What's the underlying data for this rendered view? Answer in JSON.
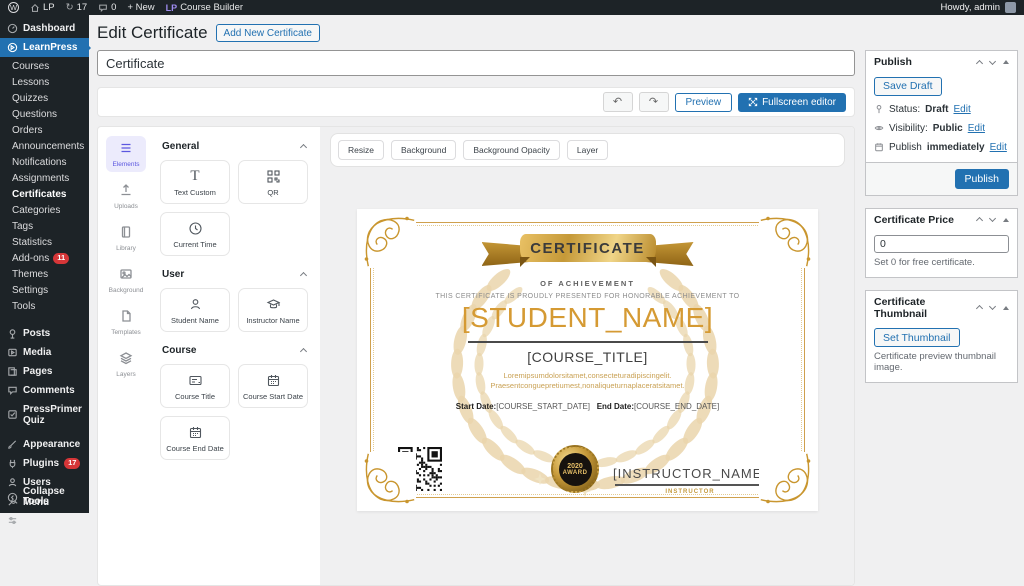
{
  "admin_bar": {
    "wp": "W",
    "site": "LP",
    "updates": "17",
    "comments": "0",
    "new_label": "+ New",
    "builder_logo": "LP",
    "builder": "Course Builder",
    "update_glyph": "↻",
    "howdy": "Howdy, admin"
  },
  "sidebar": {
    "dashboard": "Dashboard",
    "learnpress": "LearnPress",
    "lp_submenu": [
      "Courses",
      "Lessons",
      "Quizzes",
      "Questions",
      "Orders",
      "Announcements",
      "Notifications",
      "Assignments",
      "Certificates",
      "Categories",
      "Tags",
      "Statistics",
      "Add-ons",
      "Themes",
      "Settings",
      "Tools"
    ],
    "addons_badge": "11",
    "lower": [
      {
        "label": "Posts"
      },
      {
        "label": "Media"
      },
      {
        "label": "Pages"
      },
      {
        "label": "Comments"
      },
      {
        "label": "PressPrimer Quiz"
      },
      {
        "label": "Appearance"
      },
      {
        "label": "Plugins",
        "badge": "17"
      },
      {
        "label": "Users"
      },
      {
        "label": "Tools"
      },
      {
        "label": "Settings"
      }
    ],
    "collapse": "Collapse Menu"
  },
  "header": {
    "title": "Edit Certificate",
    "add_new": "Add New Certificate"
  },
  "title_input": {
    "value": "Certificate"
  },
  "toolbar": {
    "undo": "↶",
    "redo": "↷",
    "preview": "Preview",
    "fullscreen": "Fullscreen editor"
  },
  "tabs": [
    {
      "label": "Elements"
    },
    {
      "label": "Uploads"
    },
    {
      "label": "Library"
    },
    {
      "label": "Background"
    },
    {
      "label": "Templates"
    },
    {
      "label": "Layers"
    }
  ],
  "sections": {
    "general": {
      "title": "General",
      "text_custom": "Text Custom",
      "qr": "QR",
      "current_time": "Current Time"
    },
    "user": {
      "title": "User",
      "student": "Student Name",
      "instructor": "Instructor Name"
    },
    "course": {
      "title": "Course",
      "course_title": "Course Title",
      "start": "Course Start Date",
      "end": "Course End Date"
    }
  },
  "icons": {
    "text_glyph": "T"
  },
  "canvas_toolbar": {
    "resize": "Resize",
    "background": "Background",
    "bg_opacity": "Background Opacity",
    "layer": "Layer"
  },
  "certificate": {
    "ribbon_title": "CERTIFICATE",
    "subtitle": "OF ACHIEVEMENT",
    "presented": "THIS CERTIFICATE IS PROUDLY PRESENTED FOR HONORABLE ACHIEVEMENT TO",
    "student_name": "[STUDENT_NAME]",
    "course_title": "[COURSE_TITLE]",
    "lorem1": "Loremipsumdolorsitamet,consecteturadipiscingelit.",
    "lorem2": "Praesentconguepretiumest,nonaliqueturnaplaceratsitamet.",
    "start_label": "Start Date:",
    "start_value": "[COURSE_START_DATE]",
    "end_label": "End Date:",
    "end_value": "[COURSE_END_DATE]",
    "award_year": "2020",
    "award_label": "AWARD",
    "instructor_name": "[INSTRUCTOR_NAME]",
    "instructor_label": "INSTRUCTOR"
  },
  "publish": {
    "title": "Publish",
    "save_draft": "Save Draft",
    "status_label": "Status:",
    "status_value": "Draft",
    "visibility_label": "Visibility:",
    "visibility_value": "Public",
    "publish_label": "Publish",
    "publish_when": "immediately",
    "edit": "Edit",
    "publish_button": "Publish"
  },
  "price": {
    "title": "Certificate Price",
    "value": "0",
    "help": "Set 0 for free certificate."
  },
  "thumbnail": {
    "title": "Certificate Thumbnail",
    "button": "Set Thumbnail",
    "help": "Certificate preview thumbnail image."
  },
  "colors": {
    "accent": "#2271b1",
    "purple": "#5b57e0",
    "gold": "#cfa04d",
    "badge_red": "#d63638"
  }
}
